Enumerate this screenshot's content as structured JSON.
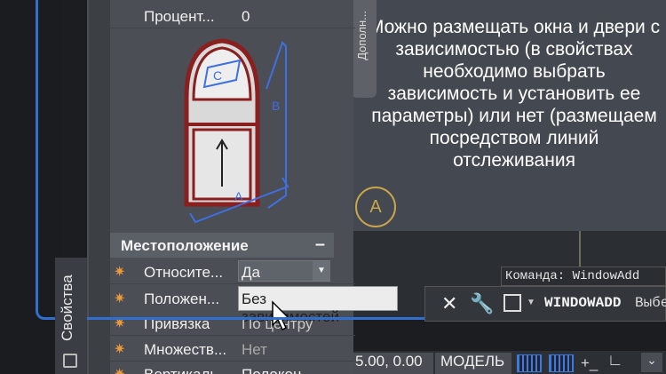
{
  "palette": {
    "accent_blue": "#2f6fd0",
    "panel": "#4b4e54",
    "section": "#5b5f66",
    "grid_circle": "#c9a54a",
    "sun_icon": "#e89a3c"
  },
  "panel": {
    "vertical_tab": "Свойства",
    "top_row": {
      "label": "Процент...",
      "value": "0"
    },
    "section_title": "Местоположение",
    "section_toggle": "–",
    "rows": [
      {
        "icon": "sun-icon",
        "label": "Относите...",
        "value": "Да"
      },
      {
        "icon": "sun-icon",
        "label": "Положен...",
        "value": "Без зависимостей"
      },
      {
        "icon": "sun-icon",
        "label": "Привязка",
        "value": "По центру"
      },
      {
        "icon": "sun-icon",
        "label": "Множеств...",
        "value": "Нет"
      },
      {
        "icon": "sun-icon",
        "label": "Вертикаль...",
        "value": "Полокон..."
      }
    ],
    "illustration": {
      "dim_a": "A",
      "dim_b": "B",
      "dim_c": "C"
    }
  },
  "drawing": {
    "side_tab": "Дополн...",
    "caption": "Можно размещать окна и двери с зависимостью (в свойствах необходимо выбрать зависимость и установить ее параметры) или нет (размещаем посредством линий отслеживания",
    "grid_bubble": "A",
    "command_line": "Команда: WindowAdd",
    "command_bar": {
      "command": "WINDOWADD",
      "suffix": "Выбе",
      "close": "✕",
      "settings": "🔧"
    }
  },
  "status_bar": {
    "coords": "5.00, 0.00",
    "model": "МОДЕЛЬ",
    "ortho": "∟",
    "plus": "+_"
  }
}
